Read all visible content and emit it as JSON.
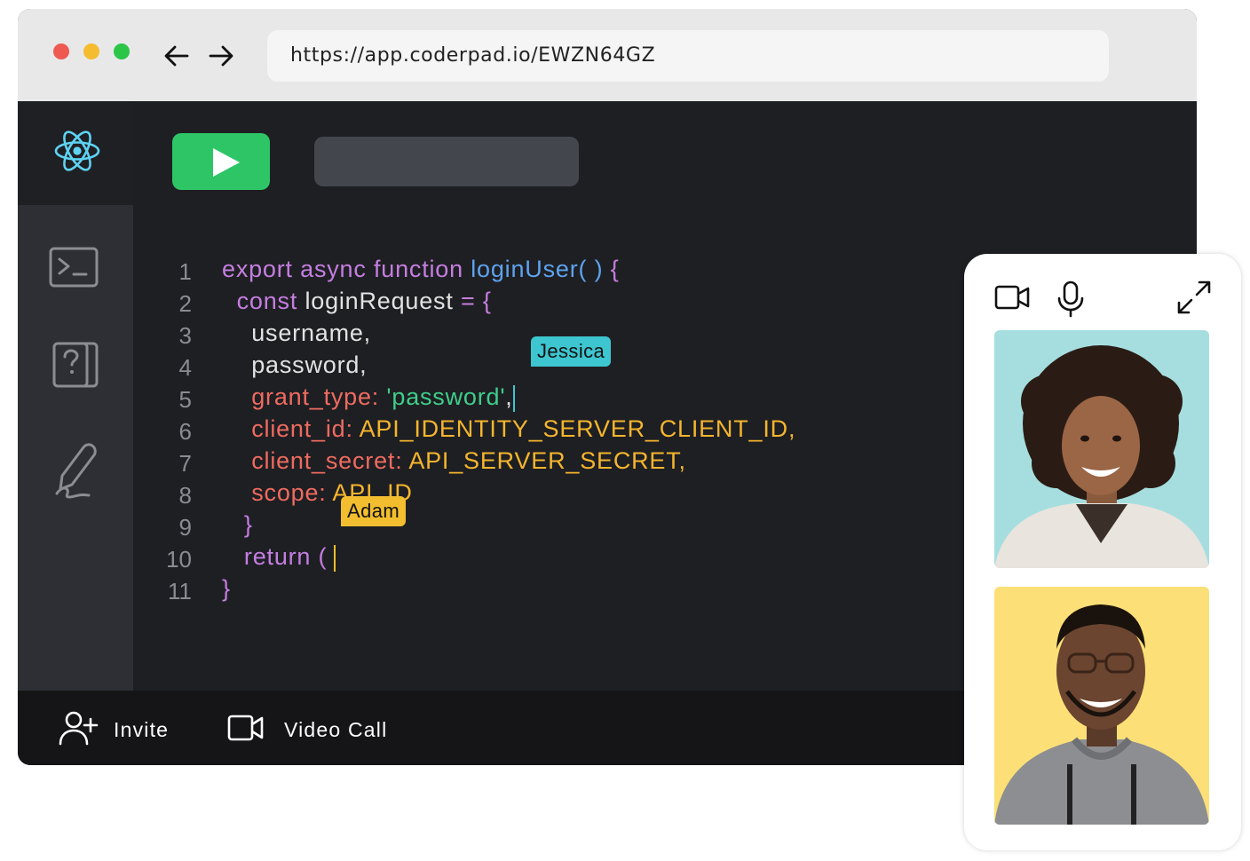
{
  "browser": {
    "url": "https://app.coderpad.io/EWZN64GZ"
  },
  "editor": {
    "line_numbers": [
      "1",
      "2",
      "3",
      "4",
      "5",
      "6",
      "7",
      "8",
      "9",
      "10",
      "11"
    ],
    "collaborators": {
      "jessica": "Jessica",
      "adam": "Adam"
    },
    "code": {
      "l1": {
        "kw": "export async function ",
        "fn": "loginUser( ) ",
        "br": "{"
      },
      "l2": {
        "indent": "  ",
        "kw": "const ",
        "name": "loginRequest ",
        "eq": "= {"
      },
      "l3": {
        "indent": "    ",
        "text": "username,"
      },
      "l4": {
        "indent": "    ",
        "text": "password,"
      },
      "l5": {
        "indent": "    ",
        "prop": "grant_type: ",
        "str": "'password'",
        "punct": ","
      },
      "l6": {
        "indent": "    ",
        "prop": "client_id: ",
        "val": "API_IDENTITY_SERVER_CLIENT_ID,"
      },
      "l7": {
        "indent": "    ",
        "prop": "client_secret: ",
        "val": "API_SERVER_SECRET,"
      },
      "l8": {
        "indent": "    ",
        "prop": "scope: ",
        "val": "API_ID"
      },
      "l9": {
        "indent": "   ",
        "br": "}"
      },
      "l10": {
        "indent": "   ",
        "kw": "return ("
      },
      "l11": {
        "br": "}"
      }
    }
  },
  "bottom_bar": {
    "invite_label": "Invite",
    "video_call_label": "Video Call"
  },
  "colors": {
    "run_button": "#2ec566",
    "keyword": "#c57ee0",
    "function": "#5ea3ef",
    "property": "#ef6b60",
    "string": "#3fce8a",
    "constant": "#f5b52d",
    "jessica_cursor": "#3dc6cf",
    "adam_cursor": "#f2be2f"
  },
  "icons": {
    "sidebar": [
      "react-icon",
      "terminal-icon",
      "question-icon",
      "pen-icon"
    ],
    "video_panel": [
      "camera-icon",
      "microphone-icon",
      "expand-icon"
    ],
    "bottom_bar": [
      "add-user-icon",
      "video-camera-icon"
    ]
  }
}
